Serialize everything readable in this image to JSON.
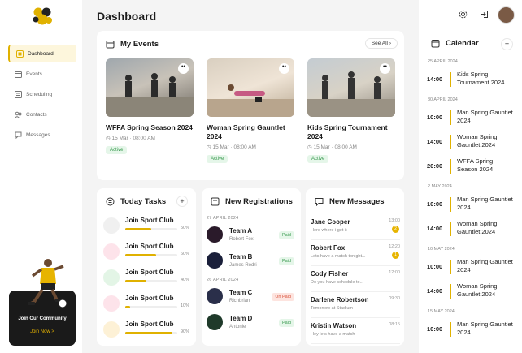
{
  "app": {
    "logo_icon": "soccer-ball-icon"
  },
  "nav": [
    {
      "label": "Dashboard",
      "icon": "dashboard-icon",
      "active": true
    },
    {
      "label": "Events",
      "icon": "calendar-icon"
    },
    {
      "label": "Scheduling",
      "icon": "schedule-icon"
    },
    {
      "label": "Contacts",
      "icon": "contacts-icon"
    },
    {
      "label": "Messages",
      "icon": "messages-icon"
    }
  ],
  "promo": {
    "title": "Join Our Community",
    "button": "Join Now >"
  },
  "page_title": "Dashboard",
  "my_events": {
    "title": "My Events",
    "see_all": "See All",
    "events": [
      {
        "title": "WFFA Spring Season 2024",
        "date": "15 Mar",
        "time": "08:00 AM",
        "status": "Active"
      },
      {
        "title": "Woman Spring Gauntlet 2024",
        "date": "15 Mar",
        "time": "08:00 AM",
        "status": "Active"
      },
      {
        "title": "Kids Spring Tournament 2024",
        "date": "15 Mar",
        "time": "08:00 AM",
        "status": "Active"
      }
    ]
  },
  "tasks": {
    "title": "Today Tasks",
    "items": [
      {
        "name": "Join Sport Club",
        "percent": 50,
        "pct_label": "50%",
        "color": "#f0f0f0"
      },
      {
        "name": "Join Sport Club",
        "percent": 60,
        "pct_label": "60%",
        "color": "#fde3ea"
      },
      {
        "name": "Join Sport Club",
        "percent": 40,
        "pct_label": "40%",
        "color": "#e3f5e6"
      },
      {
        "name": "Join Sport Club",
        "percent": 10,
        "pct_label": "10%",
        "color": "#fde3ea"
      },
      {
        "name": "Join Sport Club",
        "percent": 90,
        "pct_label": "90%",
        "color": "#fdf1d6"
      }
    ]
  },
  "registrations": {
    "title": "New Registrations",
    "groups": [
      {
        "date": "27 APRIL 2024",
        "items": [
          {
            "team": "Team A",
            "person": "Robert Fox",
            "status": "Paid",
            "paid": true
          },
          {
            "team": "Team B",
            "person": "James Rodri",
            "status": "Paid",
            "paid": true
          }
        ]
      },
      {
        "date": "26 APRIL 2024",
        "items": [
          {
            "team": "Team C",
            "person": "Richbrian",
            "status": "Un Paid",
            "paid": false
          },
          {
            "team": "Team D",
            "person": "Antonie",
            "status": "Paid",
            "paid": true
          }
        ]
      }
    ]
  },
  "messages": {
    "title": "New Messages",
    "items": [
      {
        "name": "Jane Cooper",
        "text": "Here where i get it",
        "time": "13:00",
        "count": "2"
      },
      {
        "name": "Robert Fox",
        "text": "Lets have a match tonight...",
        "time": "12:20",
        "count": "1"
      },
      {
        "name": "Cody Fisher",
        "text": "Do you have schedule to...",
        "time": "12:00",
        "count": ""
      },
      {
        "name": "Darlene Robertson",
        "text": "Tomorrow at Stadium",
        "time": "09:30",
        "count": ""
      },
      {
        "name": "Kristin Watson",
        "text": "Hey lets have a match",
        "time": "08:15",
        "count": ""
      }
    ]
  },
  "calendar": {
    "title": "Calendar",
    "groups": [
      {
        "date": "25 APRIL 2024",
        "events": [
          {
            "time": "14:00",
            "name": "Kids Spring Tournament 2024"
          }
        ]
      },
      {
        "date": "30 APRIL 2024",
        "events": [
          {
            "time": "10:00",
            "name": "Man Spring Gauntlet 2024"
          },
          {
            "time": "14:00",
            "name": "Woman Spring Gauntlet 2024"
          },
          {
            "time": "20:00",
            "name": "WFFA Spring Season 2024"
          }
        ]
      },
      {
        "date": "2 MAY 2024",
        "events": [
          {
            "time": "10:00",
            "name": "Man Spring Gauntlet 2024"
          },
          {
            "time": "14:00",
            "name": "Woman Spring Gauntlet 2024"
          }
        ]
      },
      {
        "date": "10 MAY 2024",
        "events": [
          {
            "time": "10:00",
            "name": "Man Spring Gauntlet 2024"
          },
          {
            "time": "14:00",
            "name": "Woman Spring Gauntlet 2024"
          }
        ]
      },
      {
        "date": "15 MAY 2024",
        "events": [
          {
            "time": "10:00",
            "name": "Man Spring Gauntlet 2024"
          }
        ]
      }
    ]
  },
  "colors": {
    "accent": "#e0b100",
    "background": "#f4f4f4",
    "dark": "#1a1a1a"
  }
}
